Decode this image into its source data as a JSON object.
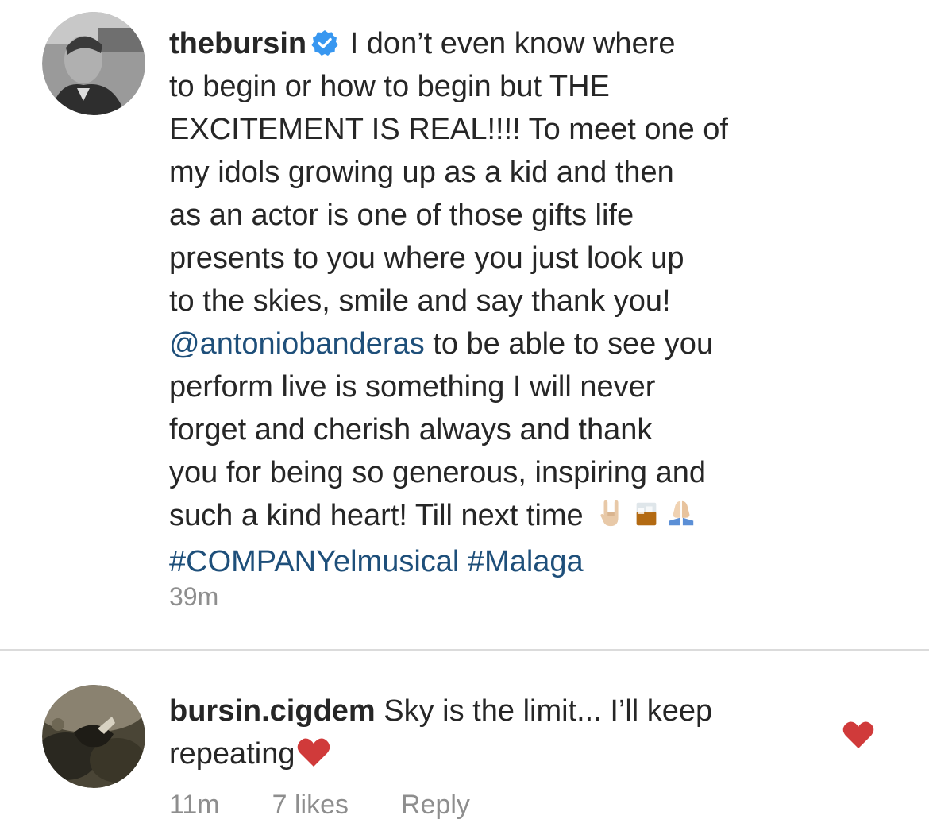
{
  "caption": {
    "username": "thebursin",
    "verified_icon": "verified-badge-icon",
    "lines": {
      "l1": "I don’t even know where",
      "l2": "to begin or how to begin but THE",
      "l3": "EXCITEMENT IS REAL!!!! To meet one of",
      "l4": "my idols growing up as a kid and then",
      "l5": "as an actor is one of those gifts life",
      "l6": "presents to you where you just look up",
      "l7": "to the skies, smile and say thank you!",
      "l8_mention": "@antoniobanderas",
      "l8_rest": " to be able to see you",
      "l9": "perform live is something I will never",
      "l10": "forget and cherish always and thank",
      "l11": "you for being so generous, inspiring and",
      "l12": "such a kind heart! Till next time",
      "hashtag1": "#COMPANYelmusical",
      "hashtag2": "#Malaga"
    },
    "emojis": [
      "rock-hand-emoji-icon",
      "whiskey-glass-emoji-icon",
      "praying-hands-emoji-icon"
    ],
    "timestamp": "39m"
  },
  "comment": {
    "username": "bursin.cigdem",
    "text_line1": "Sky is the limit... I’ll keep",
    "text_line2": "repeating",
    "inline_icon": "red-heart-emoji-icon",
    "time": "11m",
    "likes": "7 likes",
    "reply": "Reply",
    "like_icon": "heart-icon"
  },
  "colors": {
    "text": "#262626",
    "secondary": "#8e8e8e",
    "link": "#1e4f7a",
    "verified": "#3897f0",
    "heart": "#d03a3a"
  }
}
